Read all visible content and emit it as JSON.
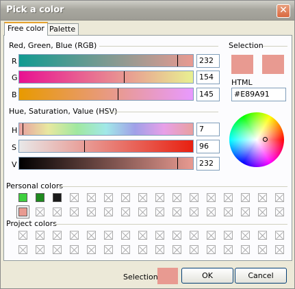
{
  "window": {
    "title": "Pick a color",
    "close_glyph": "✕"
  },
  "tabs": [
    "Free color",
    "Palette"
  ],
  "rgb": {
    "label": "Red, Green, Blue (RGB)",
    "channels": [
      {
        "letter": "R",
        "value": "232"
      },
      {
        "letter": "G",
        "value": "154"
      },
      {
        "letter": "B",
        "value": "145"
      }
    ]
  },
  "hsv": {
    "label": "Hue, Saturation, Value (HSV)",
    "channels": [
      {
        "letter": "H",
        "value": "7"
      },
      {
        "letter": "S",
        "value": "96"
      },
      {
        "letter": "V",
        "value": "232"
      }
    ]
  },
  "selection": {
    "label": "Selection",
    "color": "#E89A91",
    "html_label": "HTML",
    "html_value": "#E89A91"
  },
  "personal_colors": {
    "label": "Personal colors",
    "row1": [
      "#3ecf3e",
      "#1f8a1f",
      "#1a1a1a"
    ],
    "row2": [
      "#E89A91"
    ]
  },
  "project_colors": {
    "label": "Project colors"
  },
  "footer": {
    "selection_label": "Selection",
    "ok_label": "OK",
    "cancel_label": "Cancel"
  }
}
